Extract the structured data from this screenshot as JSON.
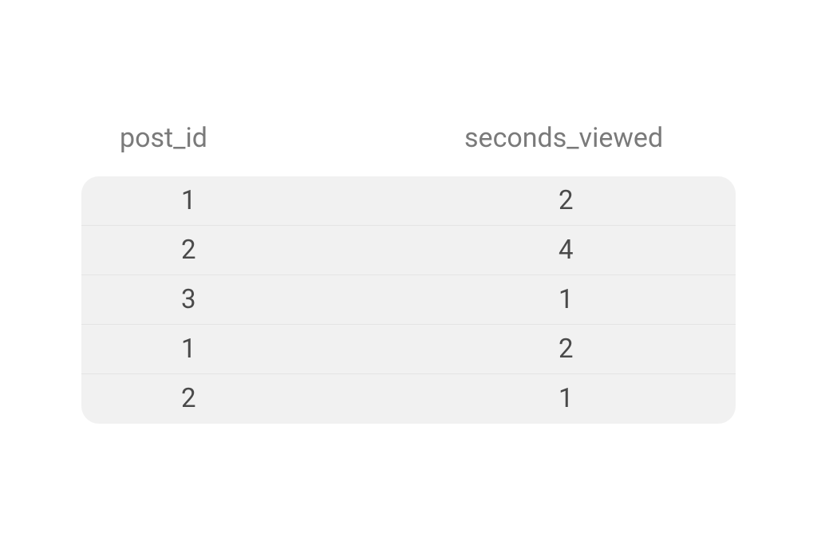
{
  "table": {
    "headers": {
      "col1": "post_id",
      "col2": "seconds_viewed"
    },
    "rows": [
      {
        "col1": "1",
        "col2": "2"
      },
      {
        "col1": "2",
        "col2": "4"
      },
      {
        "col1": "3",
        "col2": "1"
      },
      {
        "col1": "1",
        "col2": "2"
      },
      {
        "col1": "2",
        "col2": "1"
      }
    ]
  }
}
